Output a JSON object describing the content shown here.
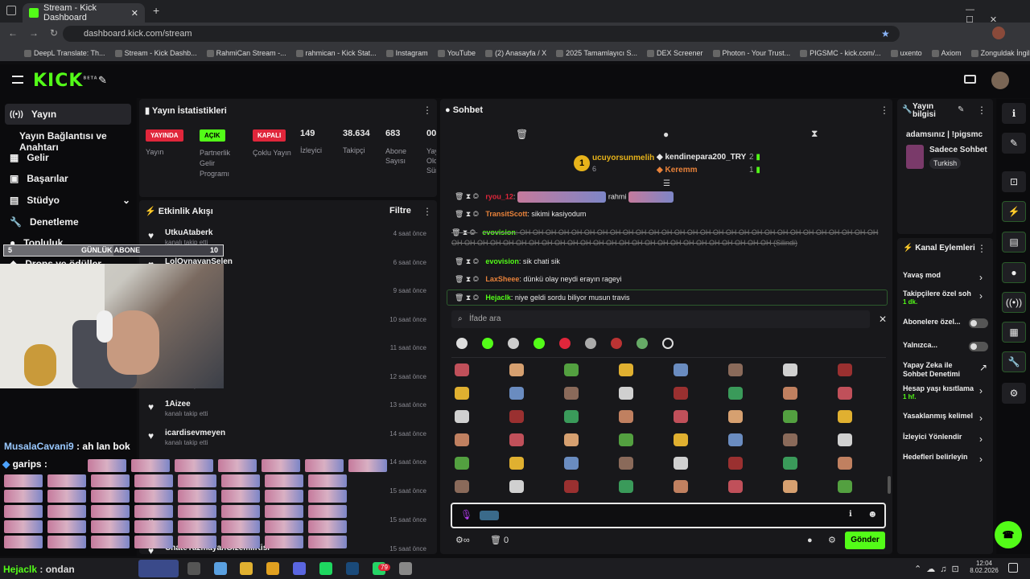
{
  "browser": {
    "tab_title": "Stream - Kick Dashboard",
    "url": "dashboard.kick.com/stream",
    "bookmarks": [
      "DeepL Translate: Th...",
      "Stream - Kick Dashb...",
      "RahmiCan Stream -...",
      "rahmican - Kick Stat...",
      "Instagram",
      "YouTube",
      "(2) Anasayfa / X",
      "2025 Tamamlayıcı S...",
      "DEX Screener",
      "Photon - Your Trust...",
      "PIGSMC - kick.com/...",
      "uxento",
      "Axiom",
      "Zonguldak İngilizce..."
    ]
  },
  "header": {
    "logo": "KICK",
    "beta": "BETA"
  },
  "nav": {
    "items": [
      "Yayın",
      "Yayın Bağlantısı ve Anahtarı",
      "Gelir",
      "Başarılar",
      "Stüdyo",
      "Denetleme",
      "Topluluk",
      "Drops ve ödüller"
    ]
  },
  "stats": {
    "title": "Yayın İstatistikleri",
    "badges": [
      {
        "text": "YAYINDA",
        "label": "Yayın",
        "color": "#e0263b"
      },
      {
        "text": "AÇIK",
        "label": "Partnerlik Gelir Programı",
        "color": "#53fc18"
      },
      {
        "text": "KAPALI",
        "label": "Çoklu Yayın",
        "color": "#e0263b"
      }
    ],
    "numbers": [
      {
        "value": "149",
        "label": "İzleyici"
      },
      {
        "value": "38.634",
        "label": "Takipçi"
      },
      {
        "value": "683",
        "label": "Abone Sayısı"
      },
      {
        "value": "00:",
        "label": "Yay Old Sür"
      }
    ]
  },
  "activity": {
    "title": "Etkinlik Akışı",
    "filter": "Filtre",
    "rows": [
      {
        "name": "UtkuAtaberk",
        "sub": "kanalı takip etti",
        "time": "4 saat önce"
      },
      {
        "name": "LolOynayanSelen",
        "sub": "",
        "time": "6 saat önce"
      },
      {
        "name": "",
        "sub": "",
        "time": "9 saat önce"
      },
      {
        "name": "",
        "sub": "",
        "time": "10 saat önce"
      },
      {
        "name": "",
        "sub": "",
        "time": "11 saat önce"
      },
      {
        "name": "",
        "sub": "kanalı takip etti",
        "time": "12 saat önce"
      },
      {
        "name": "1Aizee",
        "sub": "kanalı takip etti",
        "time": "13 saat önce"
      },
      {
        "name": "icardisevmeyen",
        "sub": "kanalı takip etti",
        "time": "14 saat önce"
      },
      {
        "name": "",
        "sub": "",
        "time": "14 saat önce"
      },
      {
        "name": "",
        "sub": "",
        "time": "15 saat önce"
      },
      {
        "name": "",
        "sub": "",
        "time": "15 saat önce"
      },
      {
        "name": "ChateYazmayanGizemliKisi",
        "sub": "",
        "time": "15 saat önce"
      }
    ]
  },
  "overlay": {
    "goal_count": "5",
    "goal_label": "GÜNLÜK ABONE",
    "goal_target": "10",
    "chat1_user": "MusalaCavani9",
    "chat1_text": "ah lan bok",
    "chat2_user": "garips",
    "bottom_user": "Hejaclk",
    "bottom_text": "ondan"
  },
  "chat": {
    "title": "Sohbet",
    "top": [
      {
        "rank": "1",
        "name": "ucuyorsunmelih",
        "count": "6"
      },
      {
        "name": "kendinepara200_TRY",
        "count": "2"
      },
      {
        "name": "Keremm",
        "count": "1"
      }
    ],
    "messages": [
      {
        "user": "ryou_12",
        "text": "rahmi",
        "color": "#e0263b"
      },
      {
        "user": "TransitScott",
        "text": "sikimi kasiyodum",
        "color": "#e8823a"
      },
      {
        "user": "evovision",
        "text": "OH OH OH OH OH OH OH OH OH OH OH OH OH OH OH OH OH OH OH OH OH OH OH OH OH OH OH OH OH OH OH OH OH OH OH OH OH OH OH OH OH OH OH OH OH OH OH OH OH OH OH OH OH (Silindi)",
        "color": "#53fc18"
      },
      {
        "user": "evovision",
        "text": "sik chati sik",
        "color": "#53fc18"
      },
      {
        "user": "LaxSheee",
        "text": "dünkü olay neydi erayın rageyi",
        "color": "#e8823a"
      },
      {
        "user": "Hejaclk",
        "text": "niye geldi sordu biliyor musun travis",
        "color": "#53fc18"
      }
    ],
    "emote_search_placeholder": "İfade ara",
    "send": "Gönder",
    "bottom_count": "0"
  },
  "info": {
    "title": "Yayın bilgisi",
    "stream_title": "adamsınız | !pigsmc",
    "mode": "Sadece Sohbet",
    "language": "Turkish"
  },
  "channel_actions": {
    "title": "Kanal Eylemleri",
    "items": [
      {
        "label": "Yavaş mod",
        "sub": ""
      },
      {
        "label": "Takipçilere özel soh",
        "sub": "1 dk."
      },
      {
        "label": "Abonelere özel...",
        "sub": ""
      },
      {
        "label": "Yalnızca...",
        "sub": ""
      },
      {
        "label": "Yapay Zeka ile Sohbet Denetimi",
        "sub": ""
      },
      {
        "label": "Hesap yaşı kısıtlama",
        "sub": "1 hf."
      },
      {
        "label": "Yasaklanmış kelimel",
        "sub": ""
      },
      {
        "label": "İzleyici Yönlendir",
        "sub": ""
      },
      {
        "label": "Hedefleri belirleyin",
        "sub": ""
      }
    ]
  },
  "taskbar": {
    "time": "12:04",
    "date": "8.02.2026",
    "badge": "79"
  },
  "colors": {
    "accent": "#53fc18",
    "panel": "#18181b",
    "bg": "#0e0e10"
  }
}
